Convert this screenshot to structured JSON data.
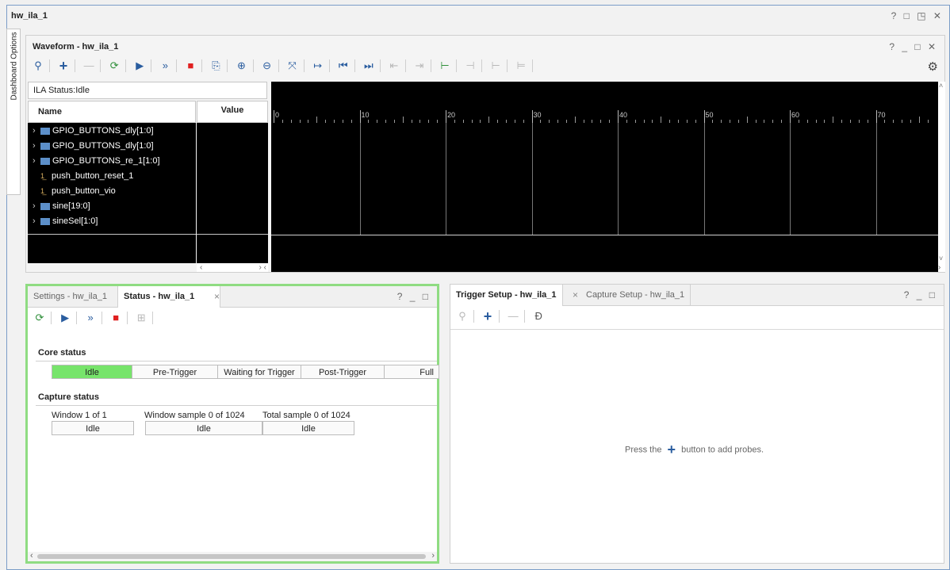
{
  "window": {
    "title": "hw_ila_1",
    "controls": "? □ ◳ ✕"
  },
  "side_tab": {
    "label": "Dashboard Options"
  },
  "waveform": {
    "title": "Waveform - hw_ila_1",
    "controls": "? _ □ ✕",
    "ila_status": "ILA Status:Idle",
    "col_name": "Name",
    "col_value": "Value",
    "signals": [
      {
        "label": "GPIO_BUTTONS_dly[1:0]",
        "type": "bus"
      },
      {
        "label": "GPIO_BUTTONS_dly[1:0]",
        "type": "bus"
      },
      {
        "label": "GPIO_BUTTONS_re_1[1:0]",
        "type": "bus"
      },
      {
        "label": "push_button_reset_1",
        "type": "bit"
      },
      {
        "label": "push_button_vio",
        "type": "bit"
      },
      {
        "label": "sine[19:0]",
        "type": "bus"
      },
      {
        "label": "sineSel[1:0]",
        "type": "bus"
      }
    ],
    "ruler_ticks": [
      "0",
      "10",
      "20",
      "30",
      "40",
      "50",
      "60",
      "70"
    ]
  },
  "status_panel": {
    "tab_settings": "Settings - hw_ila_1",
    "tab_status": "Status - hw_ila_1",
    "tab_close": "×",
    "controls": "? _ □",
    "core_status_heading": "Core status",
    "core_states": [
      "Idle",
      "Pre-Trigger",
      "Waiting for Trigger",
      "Post-Trigger",
      "Full"
    ],
    "active_state": "Idle",
    "capture_status_heading": "Capture status",
    "capture": [
      {
        "label": "Window 1 of 1",
        "value": "Idle"
      },
      {
        "label": "Window sample 0 of 1024",
        "value": "Idle"
      },
      {
        "label": "Total sample 0 of 1024",
        "value": "Idle"
      }
    ]
  },
  "trigger_panel": {
    "tab_trigger": "Trigger Setup - hw_ila_1",
    "tab_close": "×",
    "tab_capture": "Capture Setup - hw_ila_1",
    "controls": "? _ □",
    "msg_before": "Press the",
    "msg_after": "button to add probes."
  },
  "colors": {
    "accent": "#2a5d9f",
    "active_green": "#77e46b",
    "panel_highlight": "#8fdc82",
    "stop_red": "#e02020"
  }
}
